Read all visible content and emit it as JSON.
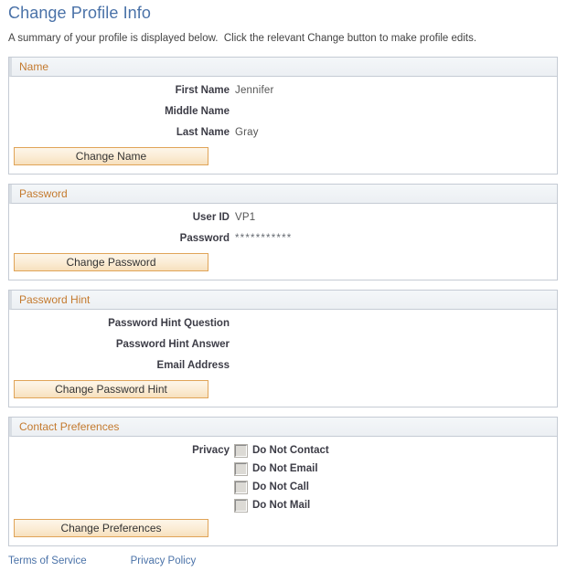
{
  "page": {
    "title": "Change Profile Info",
    "subtitle": "A summary of your profile is displayed below.  Click the relevant Change button to make profile edits."
  },
  "sections": {
    "name": {
      "header": "Name",
      "fields": [
        {
          "label": "First Name",
          "value": "Jennifer"
        },
        {
          "label": "Middle Name",
          "value": ""
        },
        {
          "label": "Last Name",
          "value": "Gray"
        }
      ],
      "button": "Change Name"
    },
    "password": {
      "header": "Password",
      "fields": [
        {
          "label": "User ID",
          "value": "VP1"
        },
        {
          "label": "Password",
          "value": "***********"
        }
      ],
      "button": "Change Password"
    },
    "password_hint": {
      "header": "Password Hint",
      "fields": [
        {
          "label": "Password Hint Question",
          "value": ""
        },
        {
          "label": "Password Hint Answer",
          "value": ""
        },
        {
          "label": "Email Address",
          "value": ""
        }
      ],
      "button": "Change Password Hint"
    },
    "contact_preferences": {
      "header": "Contact Preferences",
      "privacy_label": "Privacy",
      "options": [
        {
          "label": "Do Not Contact",
          "checked": false
        },
        {
          "label": "Do Not Email",
          "checked": false
        },
        {
          "label": "Do Not Call",
          "checked": false
        },
        {
          "label": "Do Not Mail",
          "checked": false
        }
      ],
      "button": "Change Preferences"
    }
  },
  "footer": {
    "terms_link": "Terms of Service",
    "privacy_link": "Privacy Policy"
  },
  "colors": {
    "title": "#4a72a8",
    "section_header_text": "#c47a2e",
    "button_border": "#e0a458",
    "panel_border": "#c5cbd4",
    "link": "#4a72a8"
  }
}
